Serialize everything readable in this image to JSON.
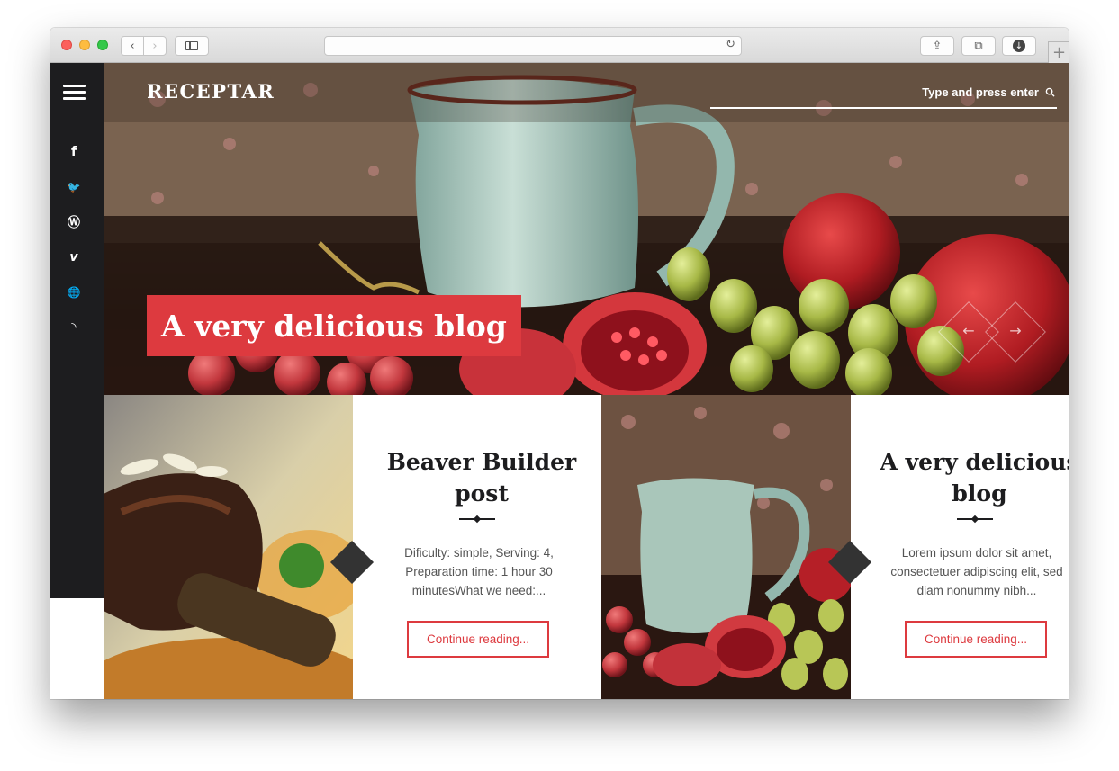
{
  "browser": {
    "back_glyph": "‹",
    "forward_glyph": "›",
    "reload_glyph": "↻",
    "share_glyph": "⇪",
    "tabs_glyph": "⧉",
    "download_glyph": "↓",
    "new_tab_glyph": "+",
    "url": ""
  },
  "site": {
    "logo": "RECEPTAR",
    "search_placeholder": "Type and press enter",
    "accent_color": "#dd3a3f",
    "sidebar_color": "#1d1d1f"
  },
  "social": [
    {
      "icon": "facebook-icon",
      "glyph": "f"
    },
    {
      "icon": "twitter-icon",
      "glyph": "🐦"
    },
    {
      "icon": "wordpress-icon",
      "glyph": "Ⓦ"
    },
    {
      "icon": "vimeo-icon",
      "glyph": "v"
    },
    {
      "icon": "globe-icon",
      "glyph": "🌐"
    },
    {
      "icon": "rss-icon",
      "glyph": "◝"
    }
  ],
  "hero": {
    "title": "A very delicious blog",
    "prev_glyph": "←",
    "next_glyph": "→"
  },
  "posts": [
    {
      "title": "Beaver Builder post",
      "excerpt": "Dificulty: simple, Serving: 4, Preparation time: 1 hour 30 minutesWhat we need:...",
      "cta": "Continue reading..."
    },
    {
      "title": "A very delicious blog",
      "excerpt": "Lorem ipsum dolor sit amet, consectetuer adipiscing elit, sed diam nonummy nibh...",
      "cta": "Continue reading..."
    }
  ]
}
